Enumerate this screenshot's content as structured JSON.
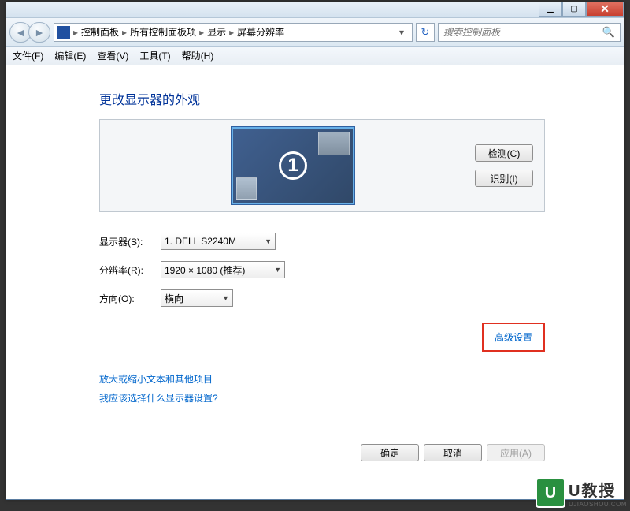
{
  "breadcrumb": {
    "root": "控制面板",
    "l2": "所有控制面板项",
    "l3": "显示",
    "l4": "屏幕分辨率"
  },
  "search": {
    "placeholder": "搜索控制面板"
  },
  "menu": {
    "file": "文件(F)",
    "edit": "编辑(E)",
    "view": "查看(V)",
    "tools": "工具(T)",
    "help": "帮助(H)"
  },
  "heading": "更改显示器的外观",
  "buttons": {
    "detect": "检测(C)",
    "identify": "识别(I)",
    "ok": "确定",
    "cancel": "取消",
    "apply": "应用(A)"
  },
  "monitor_number": "1",
  "form": {
    "display_label": "显示器(S):",
    "display_value": "1. DELL S2240M",
    "resolution_label": "分辨率(R):",
    "resolution_value": "1920 × 1080 (推荐)",
    "orientation_label": "方向(O):",
    "orientation_value": "横向"
  },
  "advanced_link": "高级设置",
  "links": {
    "text_size": "放大或缩小文本和其他项目",
    "which_display": "我应该选择什么显示器设置?"
  },
  "watermark": {
    "brand": "U教授",
    "url": "UJIAOSHOU.COM"
  }
}
